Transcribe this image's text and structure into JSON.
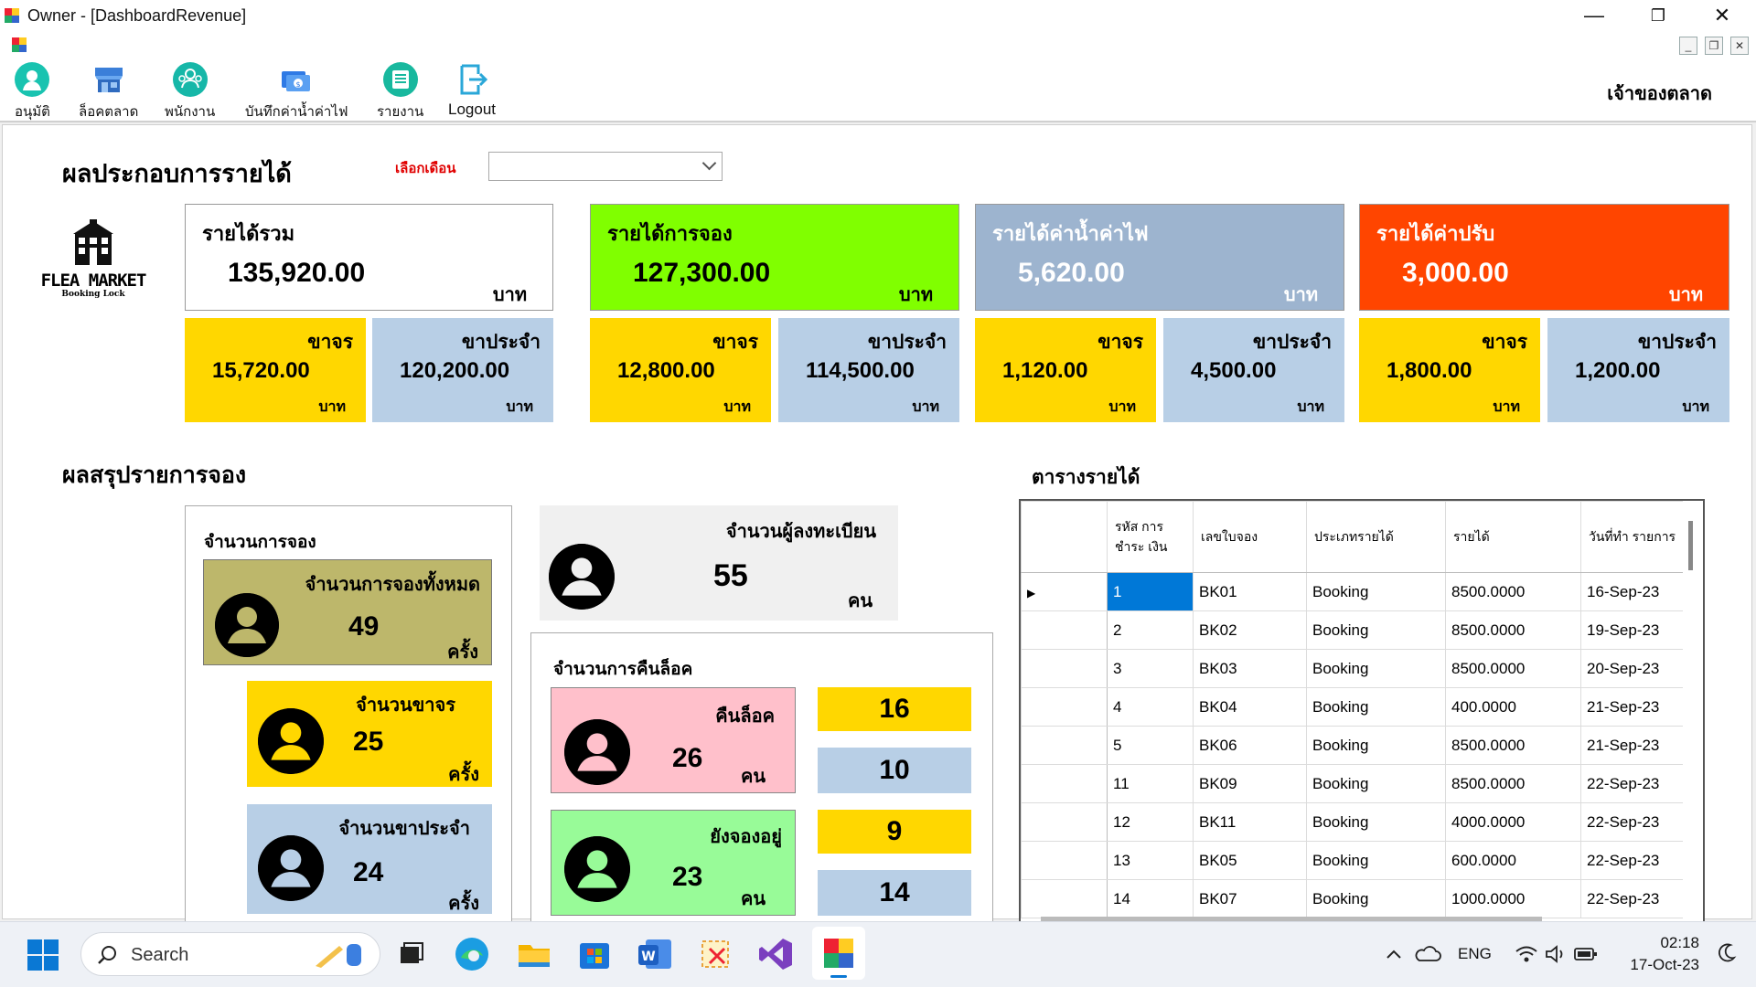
{
  "window": {
    "title": "Owner - [DashboardRevenue]",
    "minimize": "—",
    "maximize": "❐",
    "close": "✕",
    "mdi_minimize": "_",
    "mdi_restore": "❐",
    "mdi_close": "✕"
  },
  "toolbar": {
    "items": [
      {
        "label": "อนุมัติ",
        "icon": "person-check-icon"
      },
      {
        "label": "ล็อคตลาด",
        "icon": "market-stall-icon"
      },
      {
        "label": "พนักงาน",
        "icon": "staff-icon"
      },
      {
        "label": "บันทึกค่าน้ำค่าไฟ",
        "icon": "utility-bill-icon"
      },
      {
        "label": "รายงาน",
        "icon": "report-icon"
      },
      {
        "label": "Logout",
        "icon": "logout-icon"
      }
    ],
    "owner_label": "เจ้าของตลาด"
  },
  "header": {
    "title": "ผลประกอบการรายได้",
    "select_month_label": "เลือกเดือน",
    "select_month_value": ""
  },
  "logo": {
    "line1": "FLEA MARKET",
    "line2": "Booking Lock"
  },
  "revenue": [
    {
      "title": "รายได้รวม",
      "value": "135,920.00",
      "unit": "บาท",
      "bg": "#ffffff",
      "fg": "#000000",
      "walkin": {
        "label": "ขาจร",
        "value": "15,720.00",
        "unit": "บาท"
      },
      "regular": {
        "label": "ขาประจำ",
        "value": "120,200.00",
        "unit": "บาท"
      }
    },
    {
      "title": "รายได้การจอง",
      "value": "127,300.00",
      "unit": "บาท",
      "bg": "#80ff00",
      "fg": "#000000",
      "walkin": {
        "label": "ขาจร",
        "value": "12,800.00",
        "unit": "บาท"
      },
      "regular": {
        "label": "ขาประจำ",
        "value": "114,500.00",
        "unit": "บาท"
      }
    },
    {
      "title": "รายได้ค่าน้ำค่าไฟ",
      "value": "5,620.00",
      "unit": "บาท",
      "bg": "#9db4cf",
      "fg": "#ffffff",
      "walkin": {
        "label": "ขาจร",
        "value": "1,120.00",
        "unit": "บาท"
      },
      "regular": {
        "label": "ขาประจำ",
        "value": "4,500.00",
        "unit": "บาท"
      }
    },
    {
      "title": "รายได้ค่าปรับ",
      "value": "3,000.00",
      "unit": "บาท",
      "bg": "#ff4500",
      "fg": "#ffffff",
      "walkin": {
        "label": "ขาจร",
        "value": "1,800.00",
        "unit": "บาท"
      },
      "regular": {
        "label": "ขาประจำ",
        "value": "1,200.00",
        "unit": "บาท"
      }
    }
  ],
  "colors": {
    "walkin": "#ffd700",
    "regular": "#b8cfe6",
    "total_booking": "#bdb76b",
    "return_lock": "#ffc0cb",
    "still_booked": "#98fb98",
    "selection": "#0078d7"
  },
  "booking_summary": {
    "title": "ผลสรุปรายการจอง",
    "panel_title": "จำนวนการจอง",
    "total": {
      "label": "จำนวนการจองทั้งหมด",
      "value": "49",
      "unit": "ครั้ง"
    },
    "walkin": {
      "label": "จำนวนขาจร",
      "value": "25",
      "unit": "ครั้ง"
    },
    "regular": {
      "label": "จำนวนขาประจำ",
      "value": "24",
      "unit": "ครั้ง"
    }
  },
  "registered": {
    "label": "จำนวนผู้ลงทะเบียน",
    "value": "55",
    "unit": "คน"
  },
  "return_lock": {
    "panel_title": "จำนวนการคืนล็อค",
    "returned": {
      "label": "คืนล็อค",
      "value": "26",
      "unit": "คน",
      "walkin": "16",
      "regular": "10"
    },
    "booked": {
      "label": "ยังจองอยู่",
      "value": "23",
      "unit": "คน",
      "walkin": "9",
      "regular": "14"
    }
  },
  "revenue_table": {
    "title": "ตารางรายได้",
    "columns": [
      "รหัส การ ชำระ เงิน",
      "เลขใบจอง",
      "ประเภทรายได้",
      "รายได้",
      "วันที่ทำ รายการ"
    ],
    "rows": [
      [
        "1",
        "BK01",
        "Booking",
        "8500.0000",
        "16-Sep-23"
      ],
      [
        "2",
        "BK02",
        "Booking",
        "8500.0000",
        "19-Sep-23"
      ],
      [
        "3",
        "BK03",
        "Booking",
        "8500.0000",
        "20-Sep-23"
      ],
      [
        "4",
        "BK04",
        "Booking",
        "400.0000",
        "21-Sep-23"
      ],
      [
        "5",
        "BK06",
        "Booking",
        "8500.0000",
        "21-Sep-23"
      ],
      [
        "11",
        "BK09",
        "Booking",
        "8500.0000",
        "22-Sep-23"
      ],
      [
        "12",
        "BK11",
        "Booking",
        "4000.0000",
        "22-Sep-23"
      ],
      [
        "13",
        "BK05",
        "Booking",
        "600.0000",
        "22-Sep-23"
      ],
      [
        "14",
        "BK07",
        "Booking",
        "1000.0000",
        "22-Sep-23"
      ]
    ]
  },
  "taskbar": {
    "search_placeholder": "Search",
    "lang": "ENG",
    "time": "02:18",
    "date": "17-Oct-23"
  }
}
